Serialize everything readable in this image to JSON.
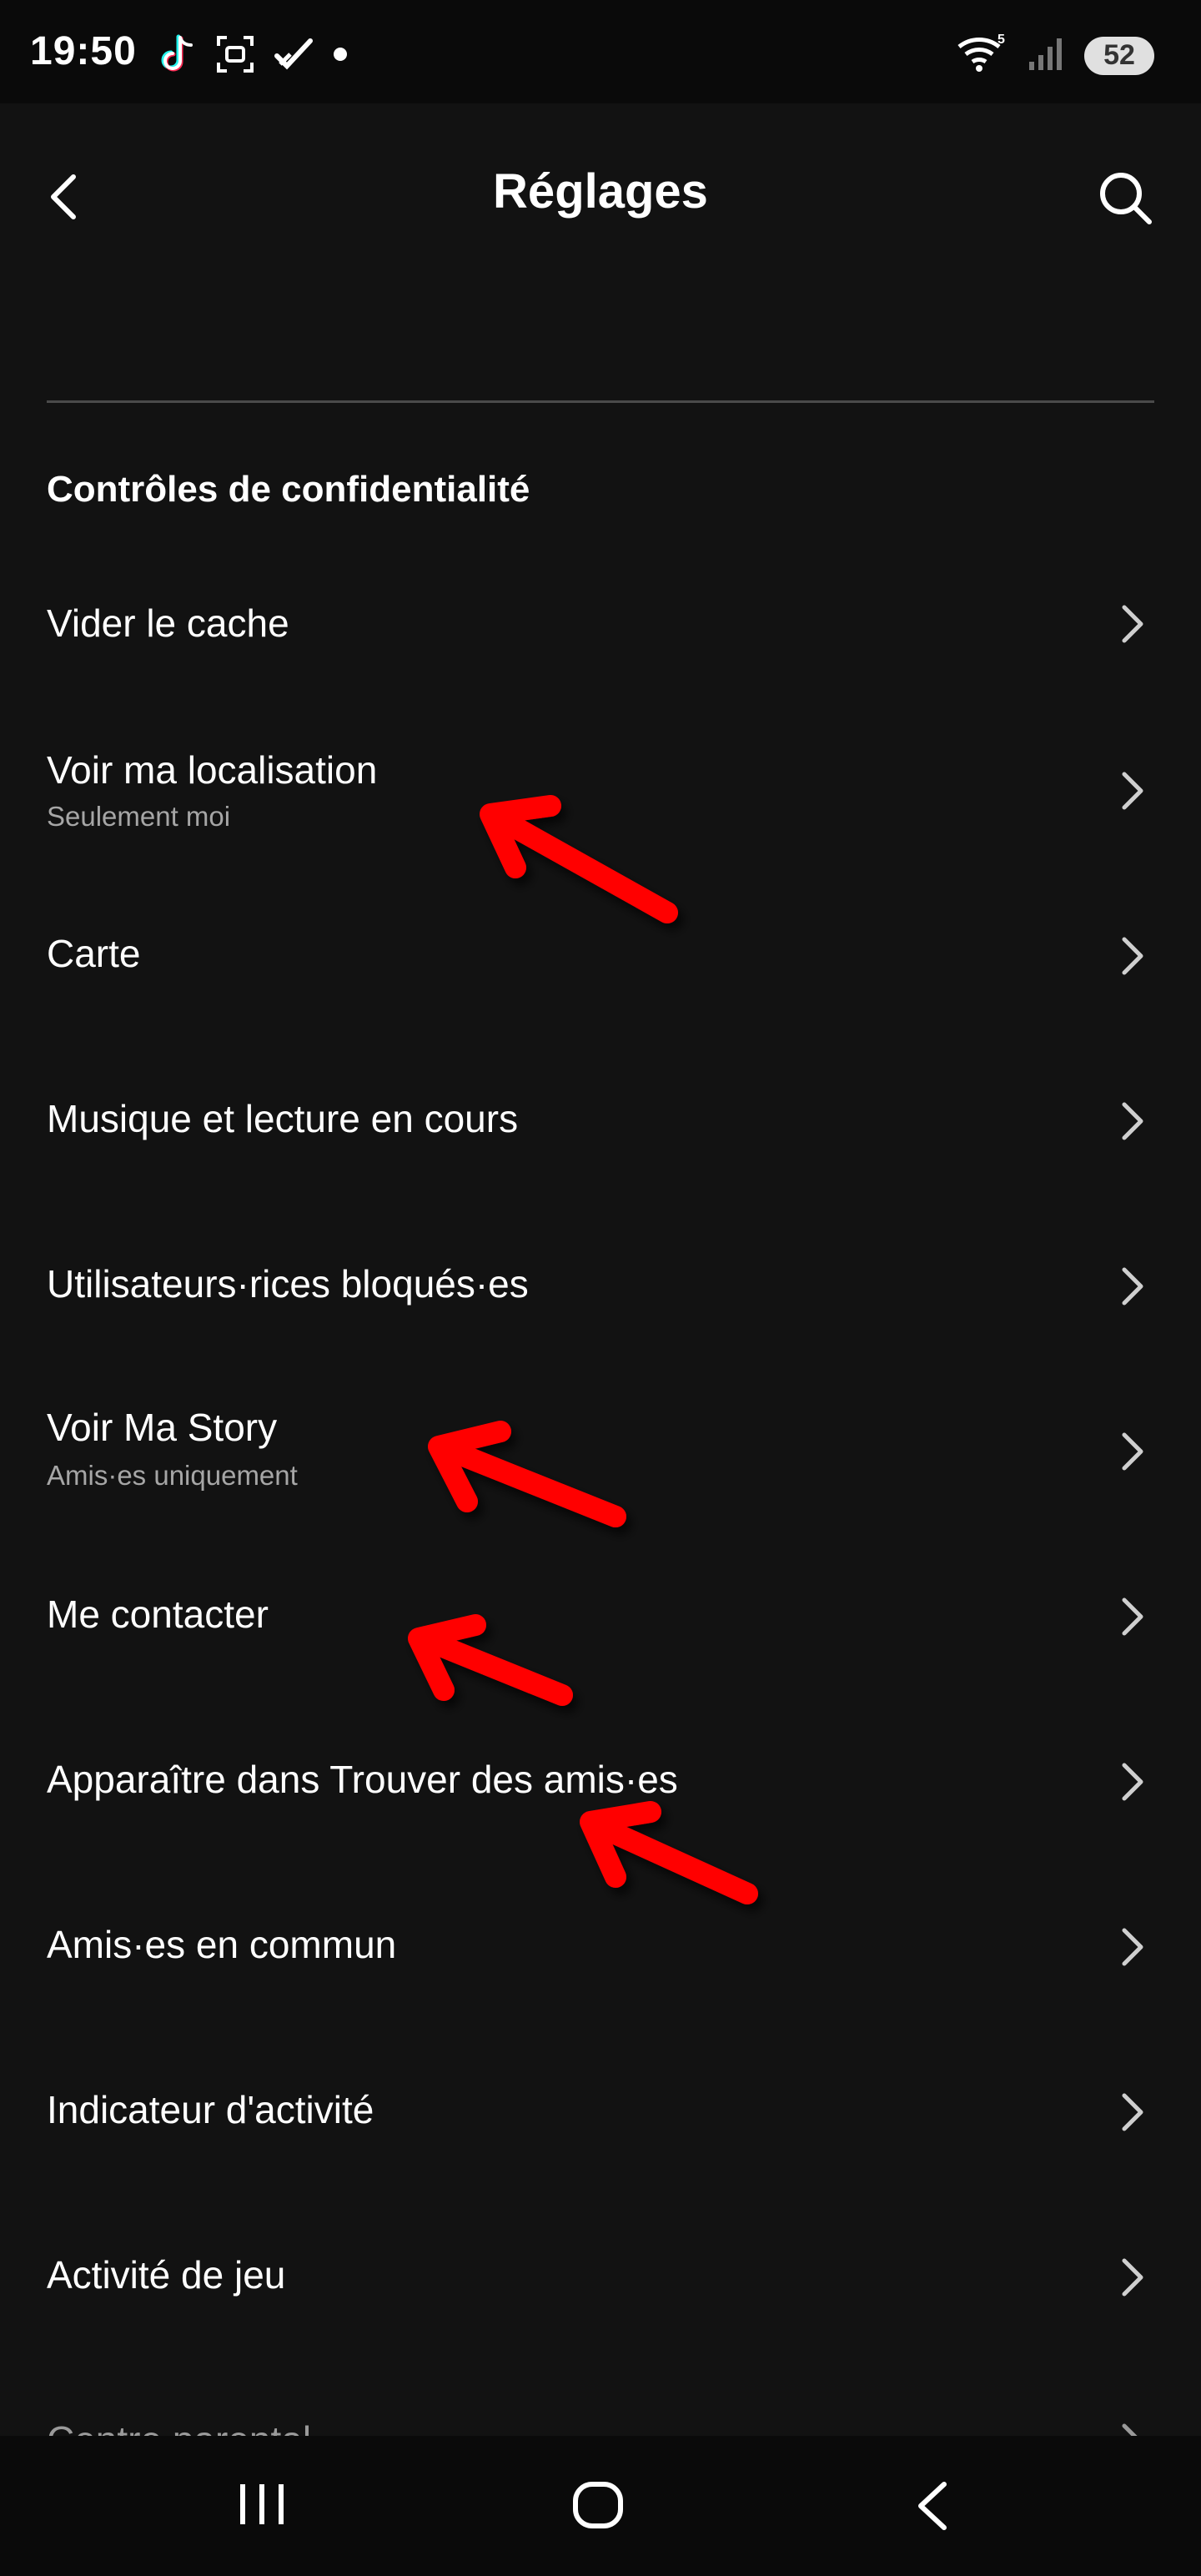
{
  "status_bar": {
    "time": "19:50",
    "battery": "52",
    "icons_left": [
      "tiktok-icon",
      "scan-icon",
      "check-icon",
      "dot-icon"
    ],
    "icons_right": [
      "wifi-icon",
      "signal-icon",
      "battery-icon"
    ]
  },
  "header": {
    "title": "Réglages",
    "back_icon": "chevron-left-icon",
    "search_icon": "search-icon"
  },
  "section": {
    "title": "Contrôles de confidentialité"
  },
  "items": [
    {
      "label": "Vider le cache",
      "sublabel": ""
    },
    {
      "label": "Voir ma localisation",
      "sublabel": "Seulement moi"
    },
    {
      "label": "Carte",
      "sublabel": ""
    },
    {
      "label": "Musique et lecture en cours",
      "sublabel": ""
    },
    {
      "label": "Utilisateurs·rices bloqués·es",
      "sublabel": ""
    },
    {
      "label": "Voir Ma Story",
      "sublabel": "Amis·es uniquement"
    },
    {
      "label": "Me contacter",
      "sublabel": ""
    },
    {
      "label": "Apparaître dans Trouver des amis·es",
      "sublabel": ""
    },
    {
      "label": "Amis·es en commun",
      "sublabel": ""
    },
    {
      "label": "Indicateur d'activité",
      "sublabel": ""
    },
    {
      "label": "Activité de jeu",
      "sublabel": ""
    },
    {
      "label": "Centre parental",
      "sublabel": ""
    }
  ],
  "nav_bar": {
    "icons": [
      "recents-icon",
      "home-icon",
      "back-icon"
    ]
  },
  "colors": {
    "background": "#121212",
    "text": "#ffffff",
    "subtext": "#a6a6a6",
    "annotation_arrow": "#ff0000"
  }
}
